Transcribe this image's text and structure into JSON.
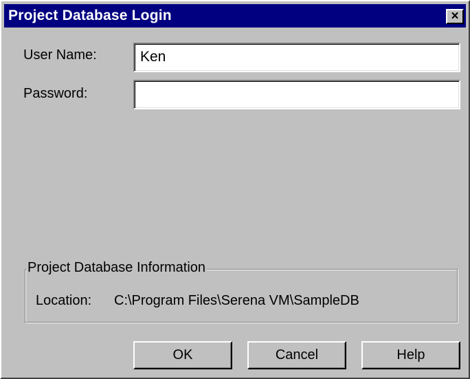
{
  "window": {
    "title": "Project Database Login",
    "close_glyph": "×"
  },
  "form": {
    "user_name_label": "User Name:",
    "user_name_value": "Ken",
    "password_label": "Password:",
    "password_value": ""
  },
  "info": {
    "group_title": "Project Database Information",
    "location_label": "Location:",
    "location_value": "C:\\Program Files\\Serena VM\\SampleDB"
  },
  "buttons": {
    "ok": "OK",
    "cancel": "Cancel",
    "help": "Help"
  },
  "colors": {
    "titlebar": "#000080",
    "face": "#c0c0c0"
  }
}
